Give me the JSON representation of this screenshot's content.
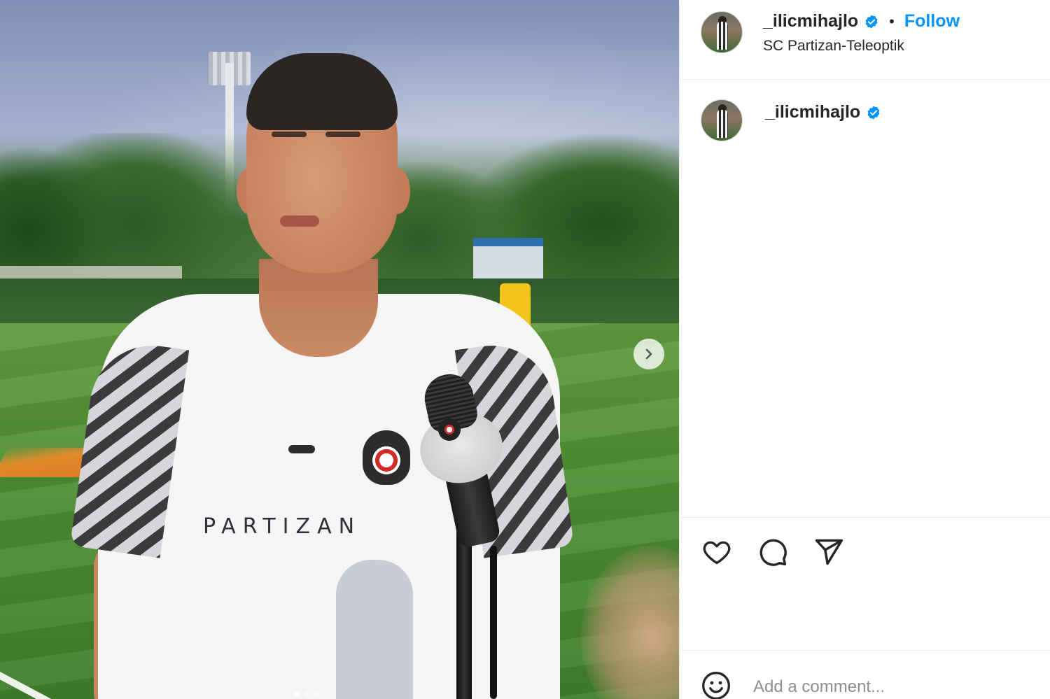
{
  "post": {
    "username": "_ilicmihajlo",
    "verified": true,
    "follow_label": "Follow",
    "bullet": "•",
    "location": "SC Partizan-Teleoptik"
  },
  "media": {
    "shirt_text": "PARTIZAN",
    "carousel_dots": 3,
    "active_dot": 0,
    "next_icon": "chevron-right-icon"
  },
  "caption": {
    "username": "_ilicmihajlo",
    "verified": true
  },
  "actions": {
    "like_icon": "heart-icon",
    "comment_icon": "comment-bubble-icon",
    "share_icon": "paper-plane-icon"
  },
  "comment": {
    "placeholder": "Add a comment...",
    "emoji_icon": "smiley-icon"
  },
  "colors": {
    "accent": "#0095f6",
    "verified": "#0095f6",
    "text": "#262626",
    "muted": "#8e8e8e"
  }
}
